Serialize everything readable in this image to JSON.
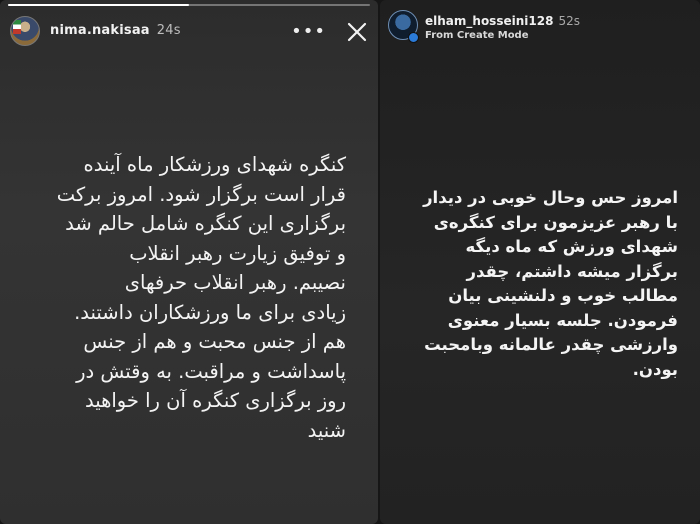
{
  "left_story": {
    "username": "nima.nakisaa",
    "time": "24s",
    "more_icon": "more-dots-icon",
    "close_icon": "close-icon",
    "progress": 0.5,
    "text": "کنگره شهدای ورزشکار ماه آینده\nقرار است برگزار شود. امروز برکت\nبرگزاری این کنگره شامل حالم شد\nو توفیق زیارت رهبر انقلاب\nنصیبم.  رهبر انقلاب حرفهای\nزیادی برای ما ورزشکاران داشتند.\nهم از جنس محبت و هم از جنس\nپاسداشت و مراقبت. به وقتش در\nروز برگزاری کنگره آن را خواهید\nشنید"
  },
  "right_story": {
    "username": "elham_hosseini128",
    "time": "52s",
    "mode_label": "From Create Mode",
    "text": "امروز حس وحال خوبی در دیدار\nبا رهبر عزیزمون برای کنگره‌ی\nشهدای ورزش که ماه دیگه\nبرگزار میشه داشتم، چقدر\nمطالب خوب و دلنشینی بیان\nفرمودن. جلسه بسیار معنوی\nوارزشی چقدر عالمانه وبامحبت\nبودن."
  }
}
